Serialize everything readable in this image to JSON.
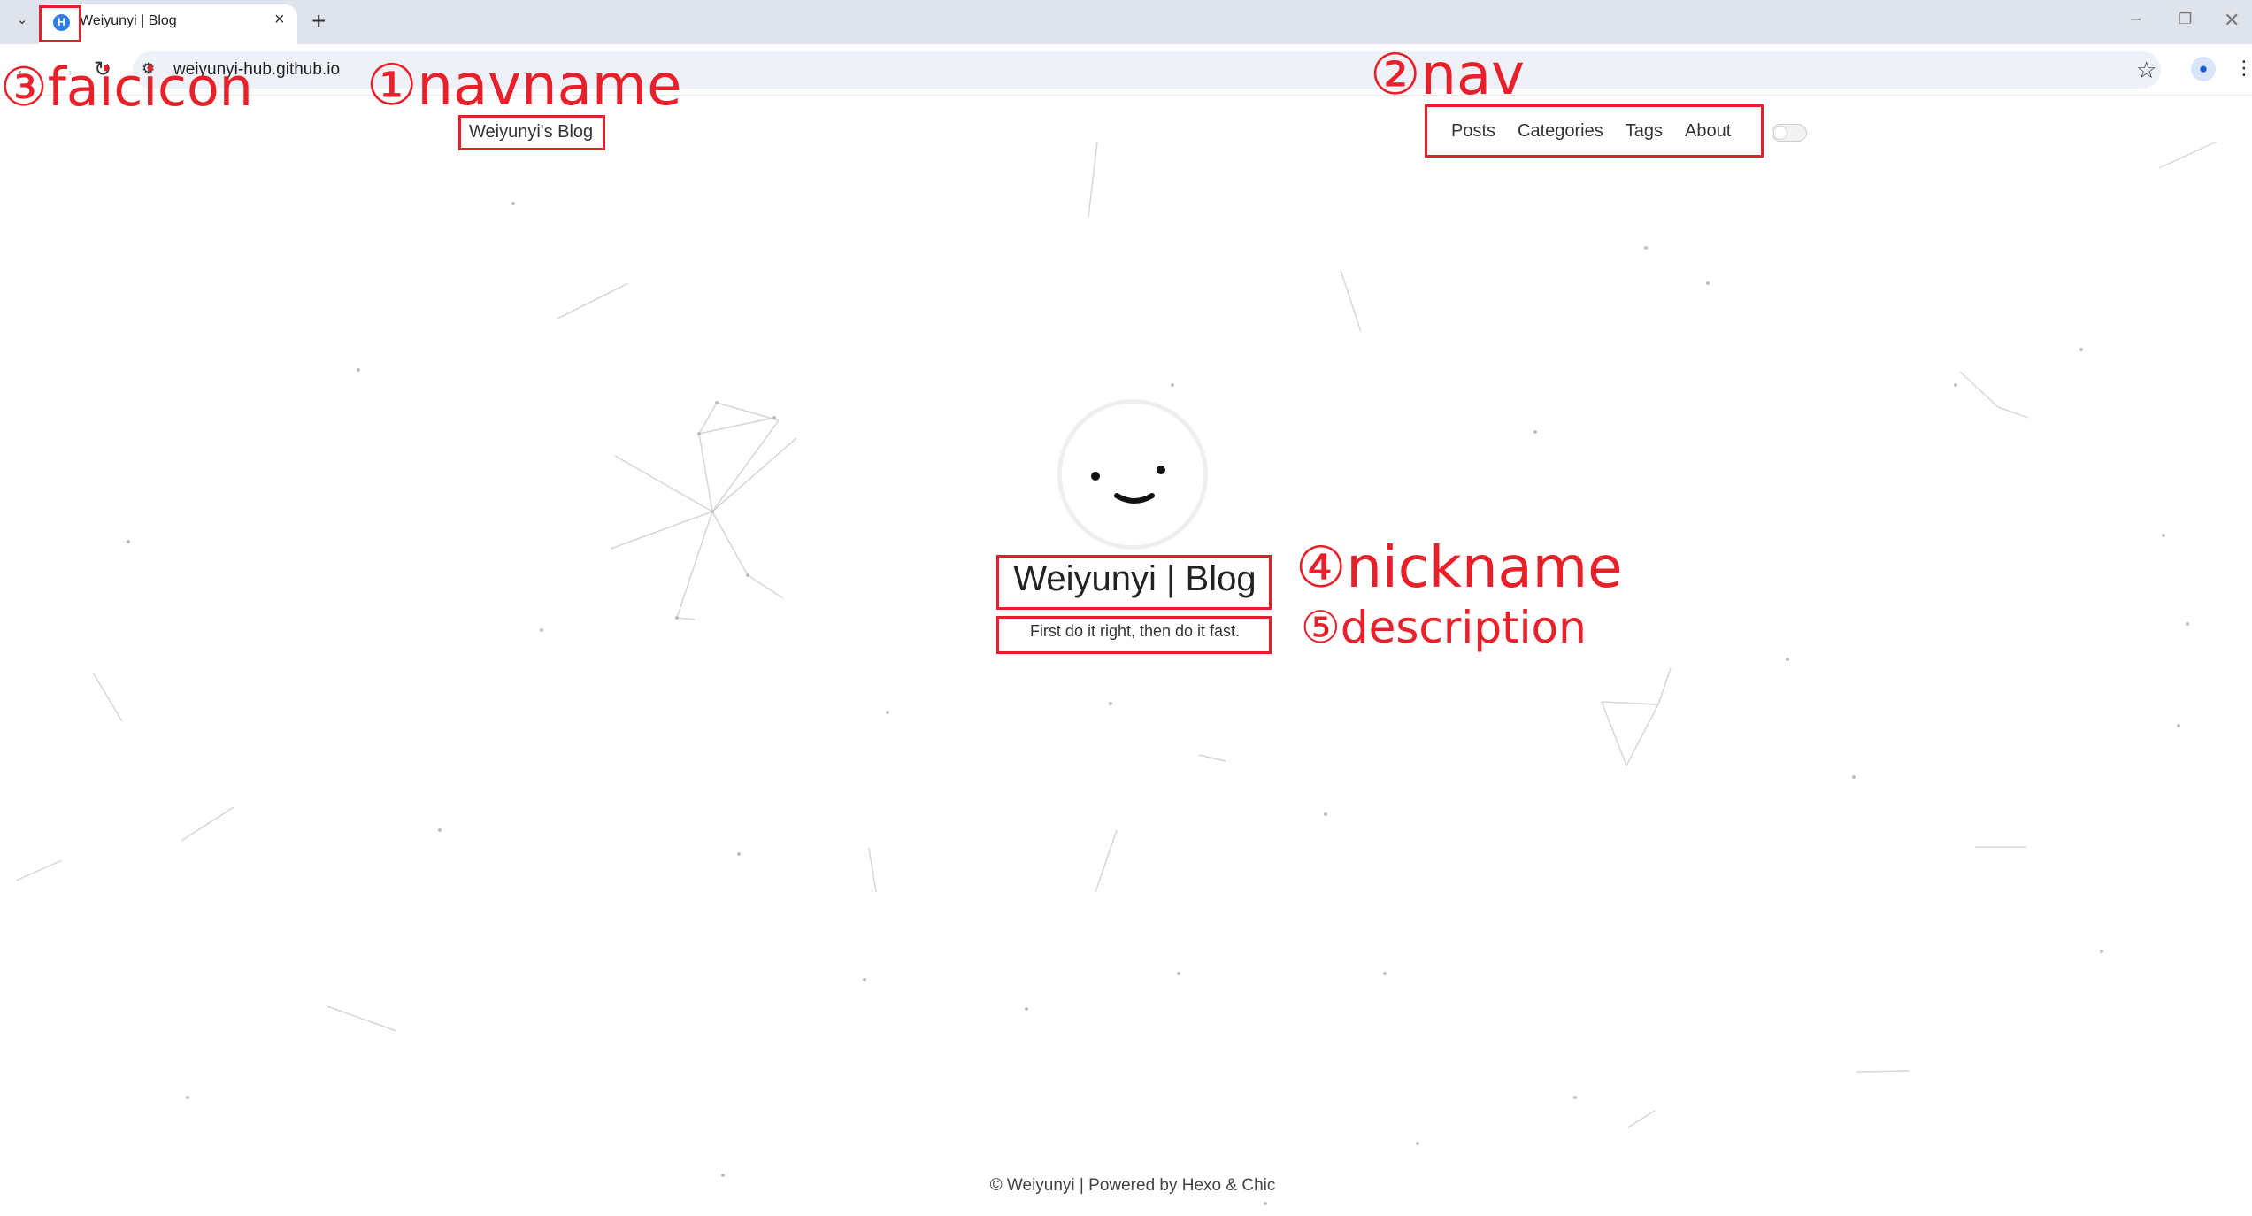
{
  "browser": {
    "tab_title": "Weiyunyi | Blog",
    "favicon_letter": "H",
    "url": "weiyunyi-hub.github.io",
    "icons": {
      "tab_list": "chevron-down-icon",
      "new_tab": "plus-icon",
      "back": "arrow-left-icon",
      "forward": "arrow-right-icon",
      "reload": "reload-icon",
      "site_info": "tune-icon",
      "bookmark": "star-icon",
      "profile": "person-icon",
      "menu": "kebab-menu-icon"
    }
  },
  "header": {
    "site_name": "Weiyunyi's Blog",
    "nav": [
      {
        "label": "Posts"
      },
      {
        "label": "Categories"
      },
      {
        "label": "Tags"
      },
      {
        "label": "About"
      }
    ]
  },
  "hero": {
    "nickname": "Weiyunyi | Blog",
    "description": "First do it right, then do it fast."
  },
  "footer": {
    "text": "© Weiyunyi | Powered by Hexo & Chic"
  },
  "annotations": {
    "navname": "①navname",
    "nav": "②nav",
    "favicon": "③faicicon",
    "nickname": "④nickname",
    "description": "⑤description"
  },
  "colors": {
    "annotation_red": "#e0202a",
    "tabstrip": "#dfe3eb",
    "favicon_blue": "#2f7fe0"
  }
}
